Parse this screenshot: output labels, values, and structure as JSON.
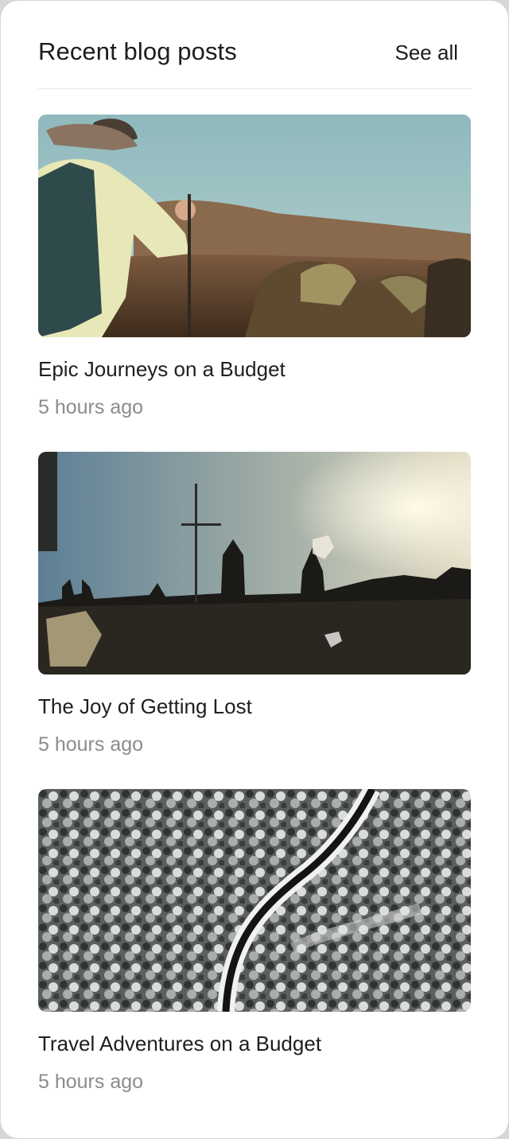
{
  "header": {
    "title": "Recent blog posts",
    "see_all_label": "See all"
  },
  "posts": [
    {
      "title": "Epic Journeys on a Budget",
      "time": "5 hours ago",
      "image": "hiker-in-desert-photo"
    },
    {
      "title": "The Joy of Getting Lost",
      "time": "5 hours ago",
      "image": "castle-skyline-at-sunset-photo"
    },
    {
      "title": "Travel Adventures on a Budget",
      "time": "5 hours ago",
      "image": "snowy-forest-road-aerial-photo"
    }
  ]
}
